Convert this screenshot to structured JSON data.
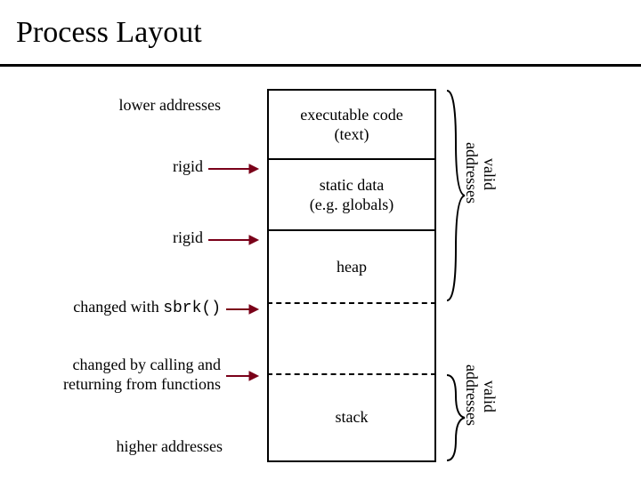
{
  "title": "Process Layout",
  "labels": {
    "lower": "lower addresses",
    "rigid1": "rigid",
    "rigid2": "rigid",
    "sbrk_pre": "changed with ",
    "sbrk_code": "sbrk()",
    "callret": "changed by calling and returning from functions",
    "higher": "higher addresses"
  },
  "segments": {
    "text_l1": "executable code",
    "text_l2": "(text)",
    "data_l1": "static data",
    "data_l2": "(e.g. globals)",
    "heap": "heap",
    "stack": "stack"
  },
  "side": {
    "valid1": "valid",
    "addr1": "addresses",
    "valid2": "valid",
    "addr2": "addresses"
  }
}
